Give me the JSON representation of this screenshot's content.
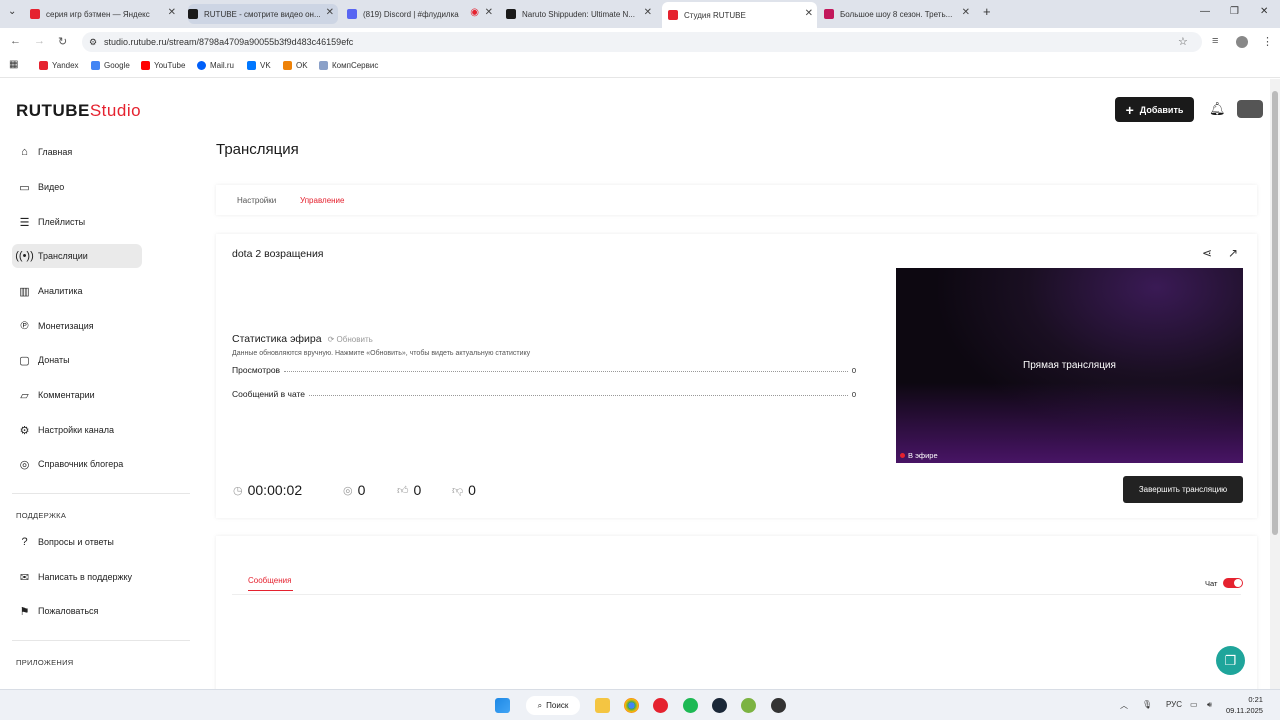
{
  "browser": {
    "tabs": [
      {
        "title": "серия игр бэтмен — Яндекс",
        "color": "#e5222f"
      },
      {
        "title": "RUTUBE - смотрите видео он...",
        "color": "#1a1a1a"
      },
      {
        "title": "(819) Discord | #флудилка",
        "color": "#5865f2"
      },
      {
        "title": "Naruto Shippuden: Ultimate N...",
        "color": "#1a1a1a"
      },
      {
        "title": "Студия RUTUBE",
        "color": "#e5222f"
      },
      {
        "title": "Большое шоу 8 сезон. Треть...",
        "color": "#c2185b"
      }
    ],
    "url": "studio.rutube.ru/stream/8798a4709a90055b3f9d483c46159efc",
    "bookmarks": [
      {
        "label": "Yandex",
        "color": "#e5222f"
      },
      {
        "label": "Google",
        "color": "#4285f4"
      },
      {
        "label": "YouTube",
        "color": "#ff0000"
      },
      {
        "label": "Mail.ru",
        "color": "#005ff9"
      },
      {
        "label": "VK",
        "color": "#0077ff"
      },
      {
        "label": "OK",
        "color": "#ee8208"
      },
      {
        "label": "КомпСервис",
        "color": "#8aa0c8"
      }
    ]
  },
  "app": {
    "logo_main": "RUTUBE",
    "logo_sub": "Studio",
    "add_button": "Добавить",
    "sidebar": {
      "items": [
        {
          "label": "Главная",
          "icon": "home-icon"
        },
        {
          "label": "Видео",
          "icon": "video-icon"
        },
        {
          "label": "Плейлисты",
          "icon": "playlist-icon"
        },
        {
          "label": "Трансляции",
          "icon": "broadcast-icon"
        },
        {
          "label": "Аналитика",
          "icon": "analytics-icon"
        },
        {
          "label": "Монетизация",
          "icon": "money-icon"
        },
        {
          "label": "Донаты",
          "icon": "donate-icon"
        },
        {
          "label": "Комментарии",
          "icon": "comments-icon"
        },
        {
          "label": "Настройки канала",
          "icon": "settings-icon"
        },
        {
          "label": "Справочник блогера",
          "icon": "handbook-icon"
        }
      ],
      "support_heading": "ПОДДЕРЖКА",
      "support_items": [
        {
          "label": "Вопросы и ответы",
          "icon": "faq-icon"
        },
        {
          "label": "Написать в поддержку",
          "icon": "mail-icon"
        },
        {
          "label": "Пожаловаться",
          "icon": "flag-icon"
        }
      ],
      "apps_heading": "ПРИЛОЖЕНИЯ"
    },
    "page_title": "Трансляция",
    "tabs": {
      "settings": "Настройки",
      "manage": "Управление"
    },
    "stream": {
      "title": "dota 2 возращения",
      "stats_heading": "Статистика эфира",
      "refresh": "Обновить",
      "stats_note": "Данные обновляются вручную. Нажмите «Обновить», чтобы видеть актуальную статистику",
      "views_label": "Просмотров",
      "views_value": "0",
      "messages_label": "Сообщений в чате",
      "messages_value": "0",
      "preview_label": "Прямая трансляция",
      "live_badge": "В эфире",
      "timer": "00:00:02",
      "viewers": "0",
      "likes": "0",
      "dislikes": "0",
      "end_button": "Завершить трансляцию"
    },
    "chat": {
      "tab": "Сообщения",
      "toggle_label": "Чат",
      "toggle_on": true
    }
  },
  "taskbar": {
    "search": "Поиск",
    "lang": "РУС",
    "time": "0:21",
    "date": "09.11.2025"
  }
}
